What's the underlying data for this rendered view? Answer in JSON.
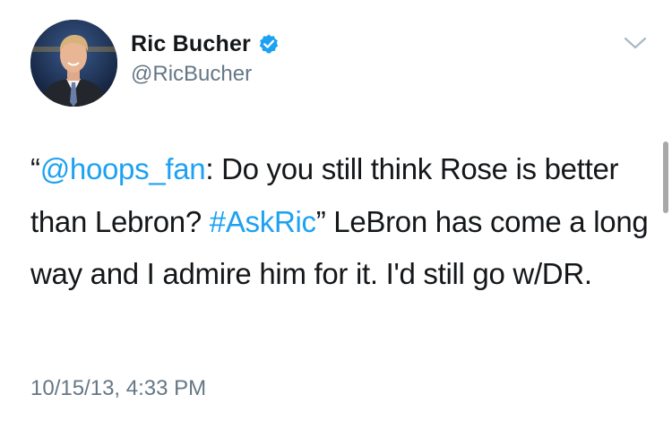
{
  "author": {
    "display_name": "Ric Bucher",
    "handle": "@RicBucher",
    "verified": true,
    "avatar_icon": "profile-photo"
  },
  "tweet": {
    "quote_open": "“",
    "mention": "@hoops_fan",
    "text_part1": ": Do you still think Rose is better than Lebron? ",
    "hashtag": "#AskRic",
    "quote_close": "”",
    "text_part2": " LeBron has come a long way and I admire him for it. I'd still go w/DR.",
    "timestamp": "10/15/13, 4:33 PM"
  },
  "icons": {
    "verified": "verified-badge-icon",
    "menu": "chevron-down-icon"
  },
  "colors": {
    "link": "#1da1f2",
    "text": "#14171a",
    "secondary": "#657786",
    "verified": "#1da1f2"
  }
}
